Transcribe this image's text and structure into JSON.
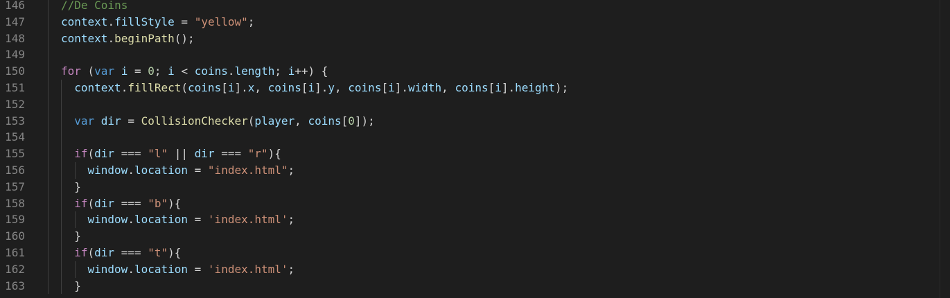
{
  "colors": {
    "background": "#1e1e1e",
    "line_number": "#858585",
    "comment": "#6a9955",
    "keyword": "#c586c0",
    "declaration": "#569cd6",
    "variable": "#9cdcfe",
    "function": "#dcdcaa",
    "string": "#ce9178",
    "number": "#b5cea8",
    "punctuation": "#d4d4d4"
  },
  "lines": [
    {
      "n": "146",
      "indent": 0,
      "tokens": [
        [
          "c",
          "//De Coins"
        ]
      ]
    },
    {
      "n": "147",
      "indent": 0,
      "tokens": [
        [
          "v",
          "context"
        ],
        [
          "p",
          "."
        ],
        [
          "v",
          "fillStyle"
        ],
        [
          "p",
          " = "
        ],
        [
          "s",
          "\"yellow\""
        ],
        [
          "p",
          ";"
        ]
      ]
    },
    {
      "n": "148",
      "indent": 0,
      "tokens": [
        [
          "v",
          "context"
        ],
        [
          "p",
          "."
        ],
        [
          "f",
          "beginPath"
        ],
        [
          "p",
          "();"
        ]
      ]
    },
    {
      "n": "149",
      "indent": 0,
      "tokens": []
    },
    {
      "n": "150",
      "indent": 0,
      "tokens": [
        [
          "k",
          "for"
        ],
        [
          "p",
          " ("
        ],
        [
          "d",
          "var"
        ],
        [
          "p",
          " "
        ],
        [
          "v",
          "i"
        ],
        [
          "p",
          " = "
        ],
        [
          "m",
          "0"
        ],
        [
          "p",
          "; "
        ],
        [
          "v",
          "i"
        ],
        [
          "p",
          " < "
        ],
        [
          "v",
          "coins"
        ],
        [
          "p",
          "."
        ],
        [
          "v",
          "length"
        ],
        [
          "p",
          "; "
        ],
        [
          "v",
          "i"
        ],
        [
          "p",
          "++) {"
        ]
      ]
    },
    {
      "n": "151",
      "indent": 1,
      "tokens": [
        [
          "v",
          "context"
        ],
        [
          "p",
          "."
        ],
        [
          "f",
          "fillRect"
        ],
        [
          "p",
          "("
        ],
        [
          "v",
          "coins"
        ],
        [
          "p",
          "["
        ],
        [
          "v",
          "i"
        ],
        [
          "p",
          "]."
        ],
        [
          "v",
          "x"
        ],
        [
          "p",
          ", "
        ],
        [
          "v",
          "coins"
        ],
        [
          "p",
          "["
        ],
        [
          "v",
          "i"
        ],
        [
          "p",
          "]."
        ],
        [
          "v",
          "y"
        ],
        [
          "p",
          ", "
        ],
        [
          "v",
          "coins"
        ],
        [
          "p",
          "["
        ],
        [
          "v",
          "i"
        ],
        [
          "p",
          "]."
        ],
        [
          "v",
          "width"
        ],
        [
          "p",
          ", "
        ],
        [
          "v",
          "coins"
        ],
        [
          "p",
          "["
        ],
        [
          "v",
          "i"
        ],
        [
          "p",
          "]."
        ],
        [
          "v",
          "height"
        ],
        [
          "p",
          ");"
        ]
      ]
    },
    {
      "n": "152",
      "indent": 1,
      "tokens": []
    },
    {
      "n": "153",
      "indent": 1,
      "tokens": [
        [
          "d",
          "var"
        ],
        [
          "p",
          " "
        ],
        [
          "v",
          "dir"
        ],
        [
          "p",
          " = "
        ],
        [
          "f",
          "CollisionChecker"
        ],
        [
          "p",
          "("
        ],
        [
          "v",
          "player"
        ],
        [
          "p",
          ", "
        ],
        [
          "v",
          "coins"
        ],
        [
          "p",
          "["
        ],
        [
          "m",
          "0"
        ],
        [
          "p",
          "]);"
        ]
      ]
    },
    {
      "n": "154",
      "indent": 1,
      "tokens": []
    },
    {
      "n": "155",
      "indent": 1,
      "tokens": [
        [
          "k",
          "if"
        ],
        [
          "p",
          "("
        ],
        [
          "v",
          "dir"
        ],
        [
          "p",
          " === "
        ],
        [
          "s",
          "\"l\""
        ],
        [
          "p",
          " || "
        ],
        [
          "v",
          "dir"
        ],
        [
          "p",
          " === "
        ],
        [
          "s",
          "\"r\""
        ],
        [
          "p",
          "){"
        ]
      ]
    },
    {
      "n": "156",
      "indent": 2,
      "tokens": [
        [
          "v",
          "window"
        ],
        [
          "p",
          "."
        ],
        [
          "v",
          "location"
        ],
        [
          "p",
          " = "
        ],
        [
          "s",
          "\"index.html\""
        ],
        [
          "p",
          ";"
        ]
      ]
    },
    {
      "n": "157",
      "indent": 1,
      "tokens": [
        [
          "p",
          "}"
        ]
      ]
    },
    {
      "n": "158",
      "indent": 1,
      "tokens": [
        [
          "k",
          "if"
        ],
        [
          "p",
          "("
        ],
        [
          "v",
          "dir"
        ],
        [
          "p",
          " === "
        ],
        [
          "s",
          "\"b\""
        ],
        [
          "p",
          "){"
        ]
      ]
    },
    {
      "n": "159",
      "indent": 2,
      "tokens": [
        [
          "v",
          "window"
        ],
        [
          "p",
          "."
        ],
        [
          "v",
          "location"
        ],
        [
          "p",
          " = "
        ],
        [
          "s",
          "'index.html'"
        ],
        [
          "p",
          ";"
        ]
      ]
    },
    {
      "n": "160",
      "indent": 1,
      "tokens": [
        [
          "p",
          "}"
        ]
      ]
    },
    {
      "n": "161",
      "indent": 1,
      "tokens": [
        [
          "k",
          "if"
        ],
        [
          "p",
          "("
        ],
        [
          "v",
          "dir"
        ],
        [
          "p",
          " === "
        ],
        [
          "s",
          "\"t\""
        ],
        [
          "p",
          "){"
        ]
      ]
    },
    {
      "n": "162",
      "indent": 2,
      "tokens": [
        [
          "v",
          "window"
        ],
        [
          "p",
          "."
        ],
        [
          "v",
          "location"
        ],
        [
          "p",
          " = "
        ],
        [
          "s",
          "'index.html'"
        ],
        [
          "p",
          ";"
        ]
      ]
    },
    {
      "n": "163",
      "indent": 1,
      "tokens": [
        [
          "p",
          "}"
        ]
      ]
    }
  ]
}
